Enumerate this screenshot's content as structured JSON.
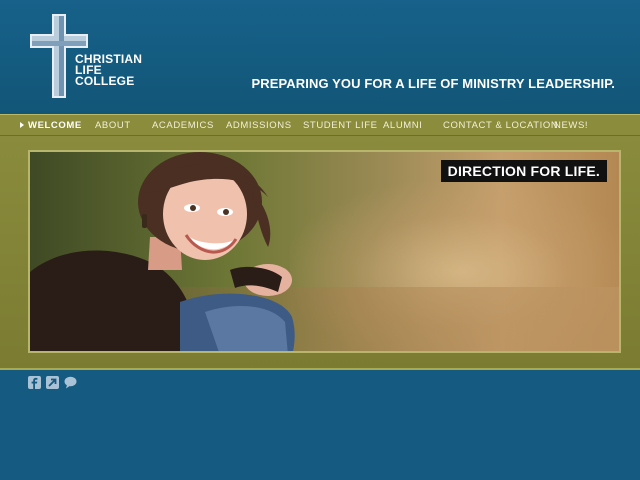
{
  "brand": {
    "name_lines": [
      "CHRISTIAN",
      "LIFE",
      "COLLEGE"
    ],
    "logo_icon": "cross-icon"
  },
  "header": {
    "tagline": "PREPARING YOU FOR A LIFE OF MINISTRY LEADERSHIP."
  },
  "nav": {
    "items": [
      {
        "label": "WELCOME",
        "active": true
      },
      {
        "label": "ABOUT"
      },
      {
        "label": "ACADEMICS"
      },
      {
        "label": "ADMISSIONS"
      },
      {
        "label": "STUDENT LIFE"
      },
      {
        "label": "ALUMNI"
      },
      {
        "label": "CONTACT & LOCATION"
      },
      {
        "label": "NEWS!"
      }
    ]
  },
  "hero": {
    "caption": "DIRECTION FOR LIFE."
  },
  "social": {
    "icons": [
      "facebook-icon",
      "share-arrow-icon",
      "speech-bubble-icon"
    ]
  },
  "colors": {
    "header_blue": "#17618a",
    "nav_olive": "#8c8c3d",
    "band_olive": "#8a8b3c",
    "caption_bg": "#111111"
  }
}
